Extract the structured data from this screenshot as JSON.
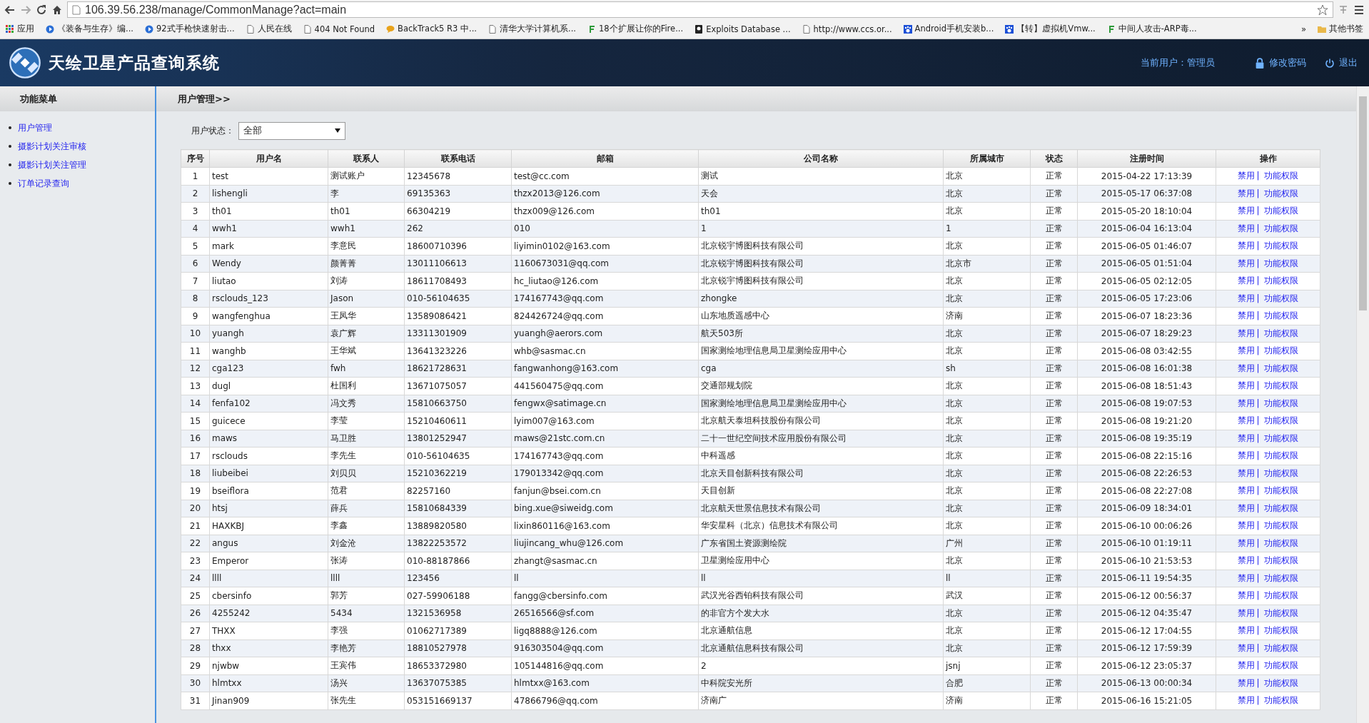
{
  "browser": {
    "url": "106.39.56.238/manage/CommonManage?act=main",
    "bookmarks": [
      {
        "label": "应用",
        "kind": "apps"
      },
      {
        "label": "《装备与生存》编...",
        "kind": "play"
      },
      {
        "label": "92式手枪快速射击...",
        "kind": "play"
      },
      {
        "label": "人民在线",
        "kind": "page"
      },
      {
        "label": "404 Not Found",
        "kind": "page"
      },
      {
        "label": "BackTrack5 R3 中...",
        "kind": "bubble"
      },
      {
        "label": "清华大学计算机系...",
        "kind": "page"
      },
      {
        "label": "18个扩展让你的Fire...",
        "kind": "leaf"
      },
      {
        "label": "Exploits Database ...",
        "kind": "mask"
      },
      {
        "label": "http://www.ccs.or...",
        "kind": "page"
      },
      {
        "label": "Android手机安装b...",
        "kind": "paw"
      },
      {
        "label": "【转】虚拟机Vmw...",
        "kind": "paw"
      },
      {
        "label": "中间人攻击-ARP毒...",
        "kind": "leaf"
      }
    ],
    "overflow": "»",
    "other_bookmarks": "其他书签"
  },
  "header": {
    "title": "天绘卫星产品查询系统",
    "current_user": "当前用户：管理员",
    "change_password": "修改密码",
    "logout": "退出"
  },
  "sidebar": {
    "title": "功能菜单",
    "items": [
      "用户管理",
      "摄影计划关注审核",
      "摄影计划关注管理",
      "订单记录查询"
    ]
  },
  "breadcrumb": "用户管理>>",
  "filter": {
    "label": "用户状态：",
    "value": "全部"
  },
  "table": {
    "columns": [
      "序号",
      "用户名",
      "联系人",
      "联系电话",
      "邮箱",
      "公司名称",
      "所属城市",
      "状态",
      "注册时间",
      "操作"
    ],
    "rows": [
      {
        "no": "1",
        "username": "test",
        "contact": "测试账户",
        "phone": "12345678",
        "email": "test@cc.com",
        "company": "测试",
        "city": "北京",
        "status": "正常",
        "registered": "2015-04-22 17:13:39",
        "actions": [
          "禁用",
          "功能权限"
        ],
        "separator": "|"
      },
      {
        "no": "2",
        "username": "lishengli",
        "contact": "李",
        "phone": "69135363",
        "email": "thzx2013@126.com",
        "company": "天会",
        "city": "北京",
        "status": "正常",
        "registered": "2015-05-17 06:37:08",
        "actions": [
          "禁用",
          "功能权限"
        ],
        "separator": "|"
      },
      {
        "no": "3",
        "username": "th01",
        "contact": "th01",
        "phone": "66304219",
        "email": "thzx009@126.com",
        "company": "th01",
        "city": "北京",
        "status": "正常",
        "registered": "2015-05-20 18:10:04",
        "actions": [
          "禁用",
          "功能权限"
        ],
        "separator": "|"
      },
      {
        "no": "4",
        "username": "wwh1",
        "contact": "wwh1",
        "phone": "262",
        "email": "010",
        "company": "1",
        "city": "1",
        "status": "正常",
        "registered": "2015-06-04 16:13:04",
        "actions": [
          "禁用",
          "功能权限"
        ],
        "separator": "|"
      },
      {
        "no": "5",
        "username": "mark",
        "contact": "李意民",
        "phone": "18600710396",
        "email": "liyimin0102@163.com",
        "company": "北京锐宇博图科技有限公司",
        "city": "北京",
        "status": "正常",
        "registered": "2015-06-05 01:46:07",
        "actions": [
          "禁用",
          "功能权限"
        ],
        "separator": "|"
      },
      {
        "no": "6",
        "username": "Wendy",
        "contact": "颜菁菁",
        "phone": "13011106613",
        "email": "1160673031@qq.com",
        "company": "北京锐宇博图科技有限公司",
        "city": "北京市",
        "status": "正常",
        "registered": "2015-06-05 01:51:04",
        "actions": [
          "禁用",
          "功能权限"
        ],
        "separator": "|"
      },
      {
        "no": "7",
        "username": "liutao",
        "contact": "刘涛",
        "phone": "18611708493",
        "email": "hc_liutao@126.com",
        "company": "北京锐宇博图科技有限公司",
        "city": "北京",
        "status": "正常",
        "registered": "2015-06-05 02:12:05",
        "actions": [
          "禁用",
          "功能权限"
        ],
        "separator": "|"
      },
      {
        "no": "8",
        "username": "rsclouds_123",
        "contact": "Jason",
        "phone": "010-56104635",
        "email": "174167743@qq.com",
        "company": "zhongke",
        "city": "北京",
        "status": "正常",
        "registered": "2015-06-05 17:23:06",
        "actions": [
          "禁用",
          "功能权限"
        ],
        "separator": "|"
      },
      {
        "no": "9",
        "username": "wangfenghua",
        "contact": "王凤华",
        "phone": "13589086421",
        "email": "824426724@qq.com",
        "company": "山东地质遥感中心",
        "city": "济南",
        "status": "正常",
        "registered": "2015-06-07 18:23:36",
        "actions": [
          "禁用",
          "功能权限"
        ],
        "separator": "|"
      },
      {
        "no": "10",
        "username": "yuangh",
        "contact": "袁广辉",
        "phone": "13311301909",
        "email": "yuangh@aerors.com",
        "company": "航天503所",
        "city": "北京",
        "status": "正常",
        "registered": "2015-06-07 18:29:23",
        "actions": [
          "禁用",
          "功能权限"
        ],
        "separator": "|"
      },
      {
        "no": "11",
        "username": "wanghb",
        "contact": "王华斌",
        "phone": "13641323226",
        "email": "whb@sasmac.cn",
        "company": "国家测绘地理信息局卫星测绘应用中心",
        "city": "北京",
        "status": "正常",
        "registered": "2015-06-08 03:42:55",
        "actions": [
          "禁用",
          "功能权限"
        ],
        "separator": "|"
      },
      {
        "no": "12",
        "username": "cga123",
        "contact": "fwh",
        "phone": "18621728631",
        "email": "fangwanhong@163.com",
        "company": "cga",
        "city": "sh",
        "status": "正常",
        "registered": "2015-06-08 16:01:38",
        "actions": [
          "禁用",
          "功能权限"
        ],
        "separator": "|"
      },
      {
        "no": "13",
        "username": "dugl",
        "contact": "杜国利",
        "phone": "13671075057",
        "email": "441560475@qq.com",
        "company": "交通部规划院",
        "city": "北京",
        "status": "正常",
        "registered": "2015-06-08 18:51:43",
        "actions": [
          "禁用",
          "功能权限"
        ],
        "separator": "|"
      },
      {
        "no": "14",
        "username": "fenfa102",
        "contact": "冯文秀",
        "phone": "15810663750",
        "email": "fengwx@satimage.cn",
        "company": "国家测绘地理信息局卫星测绘应用中心",
        "city": "北京",
        "status": "正常",
        "registered": "2015-06-08 19:07:53",
        "actions": [
          "禁用",
          "功能权限"
        ],
        "separator": "|"
      },
      {
        "no": "15",
        "username": "guicece",
        "contact": "李莹",
        "phone": "15210460611",
        "email": "lyim007@163.com",
        "company": "北京航天泰坦科技股份有限公司",
        "city": "北京",
        "status": "正常",
        "registered": "2015-06-08 19:21:20",
        "actions": [
          "禁用",
          "功能权限"
        ],
        "separator": "|"
      },
      {
        "no": "16",
        "username": "maws",
        "contact": "马卫胜",
        "phone": "13801252947",
        "email": "maws@21stc.com.cn",
        "company": "二十一世纪空间技术应用股份有限公司",
        "city": "北京",
        "status": "正常",
        "registered": "2015-06-08 19:35:19",
        "actions": [
          "禁用",
          "功能权限"
        ],
        "separator": "|"
      },
      {
        "no": "17",
        "username": "rsclouds",
        "contact": "李先生",
        "phone": "010-56104635",
        "email": "174167743@qq.com",
        "company": "中科遥感",
        "city": "北京",
        "status": "正常",
        "registered": "2015-06-08 22:15:16",
        "actions": [
          "禁用",
          "功能权限"
        ],
        "separator": "|"
      },
      {
        "no": "18",
        "username": "liubeibei",
        "contact": "刘贝贝",
        "phone": "15210362219",
        "email": "179013342@qq.com",
        "company": "北京天目创新科技有限公司",
        "city": "北京",
        "status": "正常",
        "registered": "2015-06-08 22:26:53",
        "actions": [
          "禁用",
          "功能权限"
        ],
        "separator": "|"
      },
      {
        "no": "19",
        "username": "bseiflora",
        "contact": "范君",
        "phone": "82257160",
        "email": "fanjun@bsei.com.cn",
        "company": "天目创新",
        "city": "北京",
        "status": "正常",
        "registered": "2015-06-08 22:27:08",
        "actions": [
          "禁用",
          "功能权限"
        ],
        "separator": "|"
      },
      {
        "no": "20",
        "username": "htsj",
        "contact": "薛兵",
        "phone": "15810684339",
        "email": "bing.xue@siweidg.com",
        "company": "北京航天世景信息技术有限公司",
        "city": "北京",
        "status": "正常",
        "registered": "2015-06-09 18:34:01",
        "actions": [
          "禁用",
          "功能权限"
        ],
        "separator": "|"
      },
      {
        "no": "21",
        "username": "HAXKBJ",
        "contact": "李鑫",
        "phone": "13889820580",
        "email": "lixin860116@163.com",
        "company": "华安星科（北京）信息技术有限公司",
        "city": "北京",
        "status": "正常",
        "registered": "2015-06-10 00:06:26",
        "actions": [
          "禁用",
          "功能权限"
        ],
        "separator": "|"
      },
      {
        "no": "22",
        "username": "angus",
        "contact": "刘金沧",
        "phone": "13822253572",
        "email": "liujincang_whu@126.com",
        "company": "广东省国土资源测绘院",
        "city": "广州",
        "status": "正常",
        "registered": "2015-06-10 01:19:11",
        "actions": [
          "禁用",
          "功能权限"
        ],
        "separator": "|"
      },
      {
        "no": "23",
        "username": "Emperor",
        "contact": "张涛",
        "phone": "010-88187866",
        "email": "zhangt@sasmac.cn",
        "company": "卫星测绘应用中心",
        "city": "北京",
        "status": "正常",
        "registered": "2015-06-10 21:53:53",
        "actions": [
          "禁用",
          "功能权限"
        ],
        "separator": "|"
      },
      {
        "no": "24",
        "username": "llll",
        "contact": "llll",
        "phone": "123456",
        "email": "ll",
        "company": "ll",
        "city": "ll",
        "status": "正常",
        "registered": "2015-06-11 19:54:35",
        "actions": [
          "禁用",
          "功能权限"
        ],
        "separator": "|"
      },
      {
        "no": "25",
        "username": "cbersinfo",
        "contact": "郭芳",
        "phone": "027-59906188",
        "email": "fangg@cbersinfo.com",
        "company": "武汉光谷西铂科技有限公司",
        "city": "武汉",
        "status": "正常",
        "registered": "2015-06-12 00:56:37",
        "actions": [
          "禁用",
          "功能权限"
        ],
        "separator": "|"
      },
      {
        "no": "26",
        "username": "4255242",
        "contact": "5434",
        "phone": "1321536958",
        "email": "26516566@sf.com",
        "company": "的非官方个发大水",
        "city": "北京",
        "status": "正常",
        "registered": "2015-06-12 04:35:47",
        "actions": [
          "禁用",
          "功能权限"
        ],
        "separator": "|"
      },
      {
        "no": "27",
        "username": "THXX",
        "contact": "李强",
        "phone": "01062717389",
        "email": "ligq8888@126.com",
        "company": "北京通航信息",
        "city": "北京",
        "status": "正常",
        "registered": "2015-06-12 17:04:55",
        "actions": [
          "禁用",
          "功能权限"
        ],
        "separator": "|"
      },
      {
        "no": "28",
        "username": "thxx",
        "contact": "李艳芳",
        "phone": "18810527978",
        "email": "916303504@qq.com",
        "company": "北京通航信息科技有限公司",
        "city": "北京",
        "status": "正常",
        "registered": "2015-06-12 17:59:39",
        "actions": [
          "禁用",
          "功能权限"
        ],
        "separator": "|"
      },
      {
        "no": "29",
        "username": "njwbw",
        "contact": "王宾伟",
        "phone": "18653372980",
        "email": "105144816@qq.com",
        "company": "2",
        "city": "jsnj",
        "status": "正常",
        "registered": "2015-06-12 23:05:37",
        "actions": [
          "禁用",
          "功能权限"
        ],
        "separator": "|"
      },
      {
        "no": "30",
        "username": "hlmtxx",
        "contact": "汤兴",
        "phone": "13637075385",
        "email": "hlmtxx@163.com",
        "company": "中科院安光所",
        "city": "合肥",
        "status": "正常",
        "registered": "2015-06-13 00:00:34",
        "actions": [
          "禁用",
          "功能权限"
        ],
        "separator": "|"
      },
      {
        "no": "31",
        "username": "Jinan909",
        "contact": "张先生",
        "phone": "053151669137",
        "email": "47866796@qq.com",
        "company": "济南广",
        "city": "济南",
        "status": "正常",
        "registered": "2015-06-16 15:21:05",
        "actions": [
          "禁用",
          "功能权限"
        ],
        "separator": "|"
      }
    ]
  }
}
